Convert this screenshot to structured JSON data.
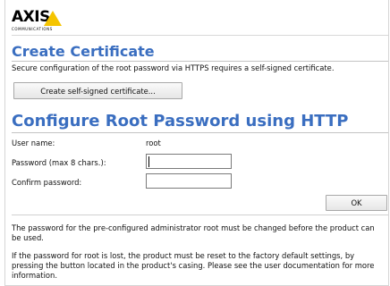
{
  "logo": {
    "name": "AXIS",
    "tagline": "COMMUNICATIONS"
  },
  "certificate": {
    "title": "Create Certificate",
    "description": "Secure configuration of the root password via HTTPS requires a self-signed certificate.",
    "button_label": "Create self-signed certificate..."
  },
  "root_password": {
    "title": "Configure Root Password using HTTP",
    "username_label": "User name:",
    "username_value": "root",
    "password_label": "Password (max 8 chars.):",
    "password_value": "",
    "confirm_label": "Confirm password:",
    "confirm_value": "",
    "ok_label": "OK"
  },
  "notes": {
    "note1": "The password for the pre-configured administrator root must be changed before the product can be used.",
    "note2": "If the password for root is lost, the product must be reset to the factory default settings, by pressing the button located in the product's casing. Please see the user documentation for more information."
  },
  "colors": {
    "heading": "#3a6ec0",
    "logo_triangle": "#f5c400"
  }
}
